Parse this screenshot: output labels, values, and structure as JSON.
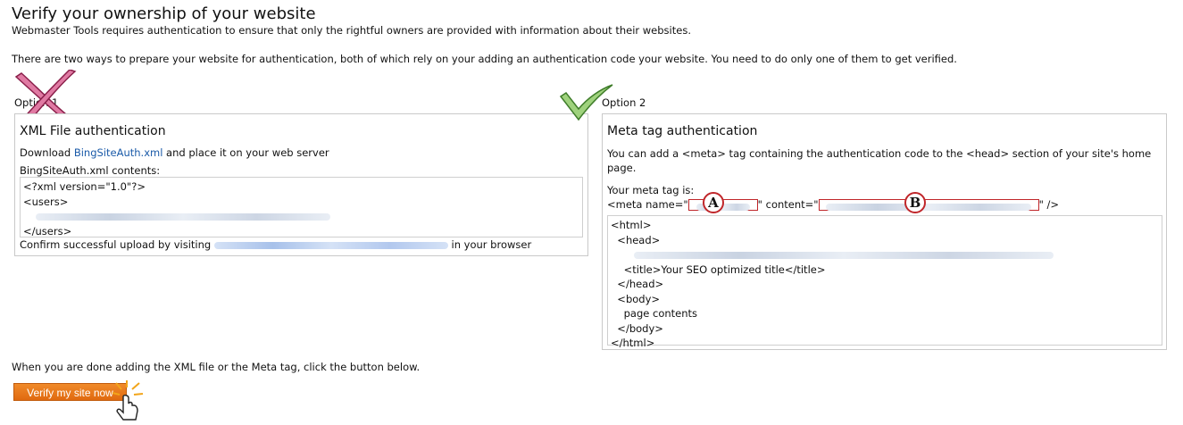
{
  "page": {
    "title": "Verify your ownership of your website",
    "subtitle": "Webmaster Tools requires authentication to ensure that only the rightful owners are provided with information about their websites.",
    "intro": "There are two ways to prepare your website for authentication, both of which rely on your adding an authentication code your website. You need to do only one of them to get verified."
  },
  "option1": {
    "label": "Option 1",
    "heading": "XML File authentication",
    "download_prefix": "Download ",
    "download_link": "BingSiteAuth.xml",
    "download_suffix": " and place it on your web server",
    "contents_label": "BingSiteAuth.xml contents:",
    "code_lines": [
      "<?xml version=\"1.0\"?>",
      "<users>",
      "</users>"
    ],
    "confirm_prefix": "Confirm successful upload by visiting ",
    "confirm_suffix": " in your browser"
  },
  "option2": {
    "label": "Option 2",
    "heading": "Meta tag authentication",
    "desc": "You can add a <meta> tag containing the authentication code to the <head> section of your site's home page.",
    "your_tag_label": "Your meta tag is:",
    "meta_prefix": "<meta name=\"",
    "meta_mid": "\" content=\"",
    "meta_suffix": "\" />",
    "marker_a": "A",
    "marker_b": "B",
    "code_lines": [
      "<html>",
      "  <head>",
      "    <title>Your SEO optimized title</title>",
      "  </head>",
      "  <body>",
      "    page contents",
      "  </body>",
      "</html>"
    ]
  },
  "footer": {
    "instruction": "When you are done adding the XML file or the Meta tag, click the button below.",
    "button_label": "Verify my site now"
  },
  "colors": {
    "accent": "#e8741a",
    "link": "#1a5aa8",
    "cross": "#c0306a",
    "check": "#5aa83a",
    "marker": "#c0262a"
  }
}
